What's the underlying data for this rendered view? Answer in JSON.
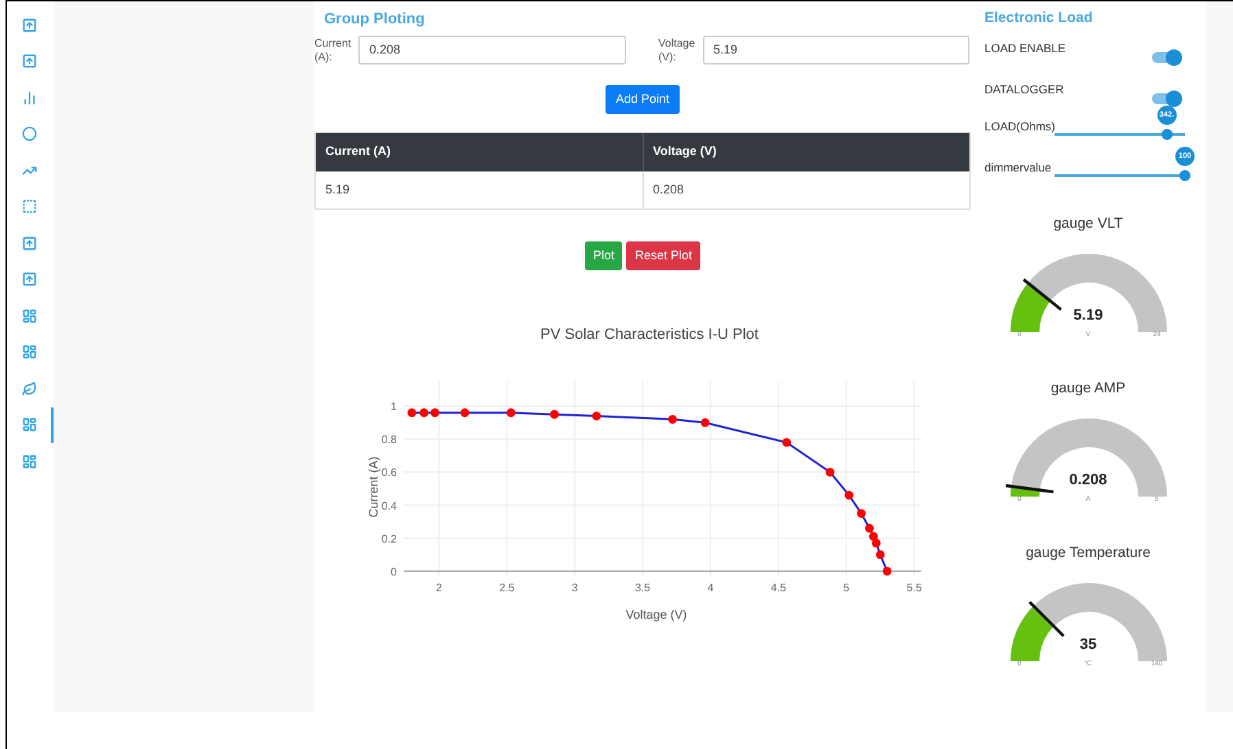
{
  "sidebar": {
    "items": [
      {
        "kind": "upload",
        "selected": false
      },
      {
        "kind": "upload",
        "selected": false
      },
      {
        "kind": "bars",
        "selected": false
      },
      {
        "kind": "circle",
        "selected": false
      },
      {
        "kind": "trend",
        "selected": false
      },
      {
        "kind": "dashed",
        "selected": false
      },
      {
        "kind": "upload",
        "selected": false
      },
      {
        "kind": "upload",
        "selected": false
      },
      {
        "kind": "dashboard",
        "selected": false
      },
      {
        "kind": "dashboard",
        "selected": false
      },
      {
        "kind": "leaf",
        "selected": false
      },
      {
        "kind": "dashboard",
        "selected": true
      },
      {
        "kind": "dashboard",
        "selected": false
      }
    ]
  },
  "group_ploting": {
    "title": "Group Ploting",
    "fields": [
      {
        "label": "Current (A):",
        "value": "0.208"
      },
      {
        "label": "Voltage (V):",
        "value": "5.19"
      }
    ],
    "add_button": "Add Point",
    "table": {
      "columns": [
        "Current (A)",
        "Voltage (V)"
      ],
      "rows": [
        [
          "5.19",
          "0.208"
        ]
      ]
    },
    "plot_button": "Plot",
    "reset_button": "Reset Plot",
    "chart_data": {
      "type": "line",
      "title": "PV Solar Characteristics I-U Plot",
      "xlabel": "Voltage (V)",
      "ylabel": "Current (A)",
      "x": [
        1.8,
        1.89,
        1.97,
        2.19,
        2.53,
        2.85,
        3.16,
        3.72,
        3.96,
        4.56,
        4.88,
        5.02,
        5.11,
        5.17,
        5.2,
        5.22,
        5.25,
        5.3
      ],
      "series": [
        {
          "color": "#2020d8",
          "marker": true,
          "values": [
            0.96,
            0.96,
            0.96,
            0.96,
            0.96,
            0.95,
            0.94,
            0.92,
            0.9,
            0.78,
            0.6,
            0.46,
            0.35,
            0.26,
            0.21,
            0.17,
            0.1,
            0
          ]
        }
      ],
      "grid": true,
      "xlim": [
        1.74,
        5.55
      ],
      "ylim": [
        -0.03,
        1.15
      ],
      "xticks": [
        2,
        2.5,
        3,
        3.5,
        4,
        4.5,
        5,
        5.5
      ],
      "yticks": [
        0,
        0.2,
        0.4,
        0.6,
        0.8,
        1
      ]
    }
  },
  "electronic_load": {
    "title": "Electronic Load",
    "controls": [
      {
        "kind": "toggle",
        "label": "LOAD ENABLE",
        "on": true
      },
      {
        "kind": "toggle",
        "label": "DATALOGGER",
        "on": true
      },
      {
        "kind": "slider",
        "label": "LOAD(Ohms)",
        "level": 0.86,
        "reading": "342."
      },
      {
        "kind": "slider",
        "label": "dimmervalue",
        "level": 1.0,
        "reading": "100"
      }
    ],
    "gauges": [
      {
        "title": "gauge VLT",
        "value": "5.19",
        "unit": "V",
        "min": "0",
        "max": "24"
      },
      {
        "title": "gauge AMP",
        "value": "0.208",
        "unit": "A",
        "min": "0",
        "max": "5"
      },
      {
        "title": "gauge Temperature",
        "value": "35",
        "unit": "°C",
        "min": "0",
        "max": "140"
      }
    ]
  }
}
